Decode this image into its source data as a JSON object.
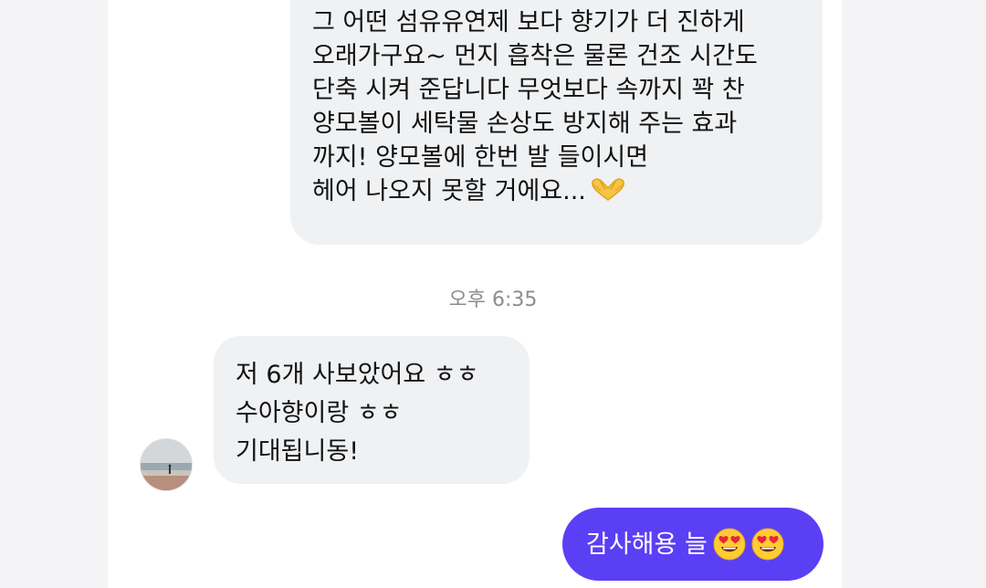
{
  "messages": {
    "incoming_top": {
      "lines": [
        "그 어떤 섬유유연제 보다 향기가 더 진하게",
        "오래가구요~ 먼지 흡착은 물론 건조 시간도",
        "단축 시켜 준답니다 무엇보다 속까지 꽉 찬",
        "양모볼이 세탁물 손상도 방지해 주는 효과",
        "까지! 양모볼에 한번 발 들이시면",
        "헤어 나오지 못할 거에요..."
      ],
      "emoji": "heart-hands-emoji"
    },
    "timestamp": "오후 6:35",
    "incoming_mid": {
      "lines": [
        "저 6개 사보았어요 ㅎㅎ",
        "수아향이랑 ㅎㅎ",
        "기대됩니동!"
      ]
    },
    "outgoing": {
      "text": "감사해용 늘",
      "emoji": [
        "smiling-face-with-heart-eyes-emoji",
        "smiling-face-with-heart-eyes-emoji"
      ]
    }
  },
  "colors": {
    "outgoing_bubble": "#5b3ff5",
    "incoming_bubble": "#eff1f3",
    "timestamp_text": "#8b8d92",
    "page_background": "#ffffff"
  }
}
